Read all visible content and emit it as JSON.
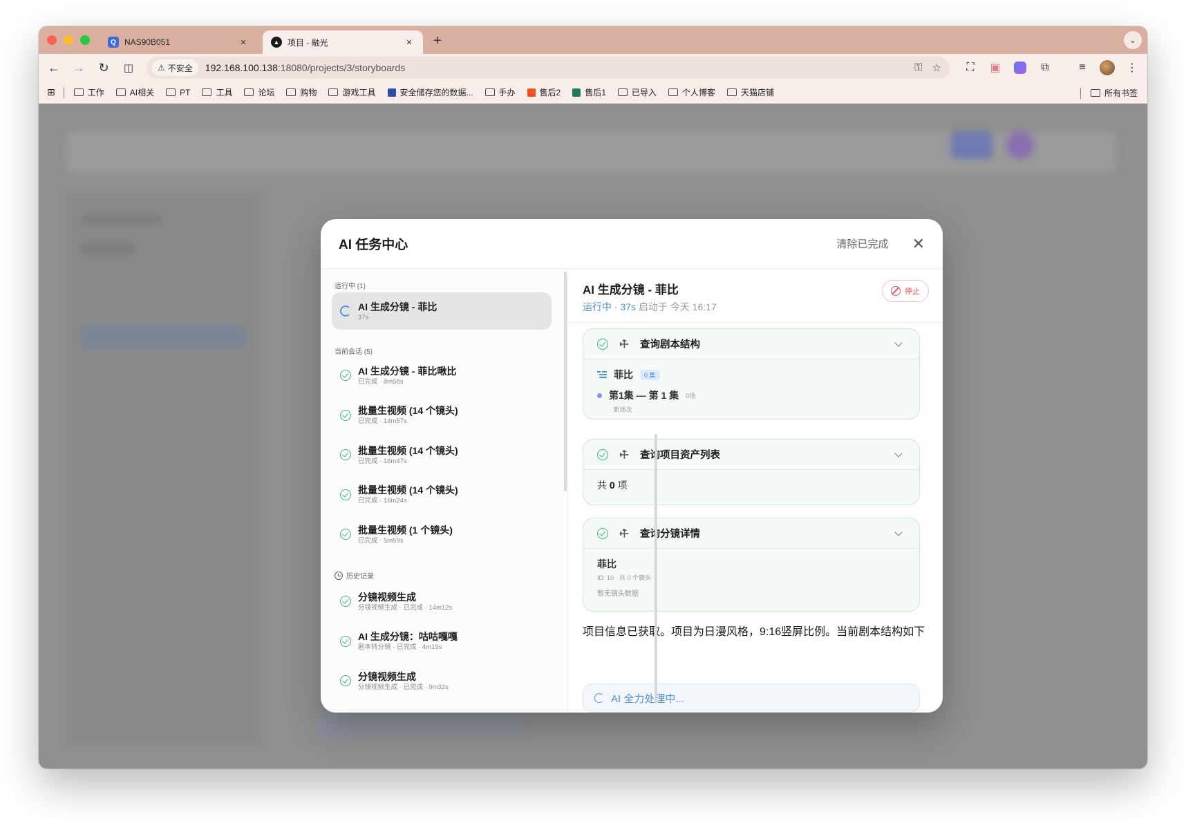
{
  "browser": {
    "tabs": [
      {
        "title": "NAS90B051",
        "favicon": "Q",
        "close": "×"
      },
      {
        "title": "项目 - 融光",
        "favicon": "▲",
        "close": "×"
      }
    ],
    "new_tab": "+",
    "tab_menu": "⌄",
    "security_label": "不安全",
    "url_host": "192.168.100.138",
    "url_path": ":18080/projects/3/storyboards",
    "bookmarks": [
      {
        "label": "工作",
        "type": "folder"
      },
      {
        "label": "AI相关",
        "type": "folder"
      },
      {
        "label": "PT",
        "type": "folder"
      },
      {
        "label": "工具",
        "type": "folder"
      },
      {
        "label": "论坛",
        "type": "folder"
      },
      {
        "label": "购物",
        "type": "folder"
      },
      {
        "label": "游戏工具",
        "type": "folder"
      },
      {
        "label": "安全储存您的数据...",
        "type": "site",
        "color": "#2d4ea8"
      },
      {
        "label": "手办",
        "type": "folder"
      },
      {
        "label": "售后2",
        "type": "site",
        "color": "#f25022"
      },
      {
        "label": "售后1",
        "type": "site",
        "color": "#1f7a5a"
      },
      {
        "label": "已导入",
        "type": "folder"
      },
      {
        "label": "个人博客",
        "type": "folder"
      },
      {
        "label": "天猫店铺",
        "type": "folder"
      }
    ],
    "all_bookmarks": "所有书签"
  },
  "modal": {
    "title": "AI 任务中心",
    "clear_completed": "清除已完成",
    "close": "✕",
    "sections": {
      "running": "运行中 (1)",
      "session": "当前会话 (5)",
      "history": "历史记录"
    },
    "running_tasks": [
      {
        "title": "AI 生成分镜 - 菲比",
        "sub": "37s"
      }
    ],
    "session_tasks": [
      {
        "title": "AI 生成分镜 - 菲比啾比",
        "sub": "已完成 · 8m58s"
      },
      {
        "title": "批量生视频 (14 个镜头)",
        "sub": "已完成 · 14m57s"
      },
      {
        "title": "批量生视频 (14 个镜头)",
        "sub": "已完成 · 16m47s"
      },
      {
        "title": "批量生视频 (14 个镜头)",
        "sub": "已完成 · 16m24s"
      },
      {
        "title": "批量生视频 (1 个镜头)",
        "sub": "已完成 · 5m59s"
      }
    ],
    "history_tasks": [
      {
        "title": "分镜视频生成",
        "sub": "分镜视频生成 · 已完成 · 14m12s"
      },
      {
        "title": "AI 生成分镜：咕咕嘎嘎",
        "sub": "剧本转分镜 · 已完成 · 4m19s"
      },
      {
        "title": "分镜视频生成",
        "sub": "分镜视频生成 · 已完成 · 9m32s"
      }
    ],
    "detail": {
      "title": "AI 生成分镜 - 菲比",
      "status": "运行中 · 37s",
      "started": "启动于 今天 16:17",
      "stop": "停止",
      "tools": [
        {
          "name": "查询剧本结构",
          "script_name": "菲比",
          "episode_count_badge": "0 集",
          "episode_title": "第1集 — 第 1 集",
          "episode_scenes": "0场",
          "episode_note": "· 新场次"
        },
        {
          "name": "查询项目资产列表",
          "total_prefix": "共",
          "total_count": "0",
          "total_suffix": "项"
        },
        {
          "name": "查询分镜详情",
          "storyboard_name": "菲比",
          "storyboard_meta": "ID: 10 · 共 0 个镜头",
          "empty_text": "暂无镜头数据"
        }
      ],
      "message": "项目信息已获取。项目为日漫风格，9:16竖屏比例。当前剧本结构如下",
      "processing": "AI 全力处理中..."
    }
  },
  "colors": {
    "tab_strip": "#d9b0a0",
    "accent_blue": "#4e8fe0",
    "success_green": "#3bb873",
    "danger_red": "#e25050"
  }
}
